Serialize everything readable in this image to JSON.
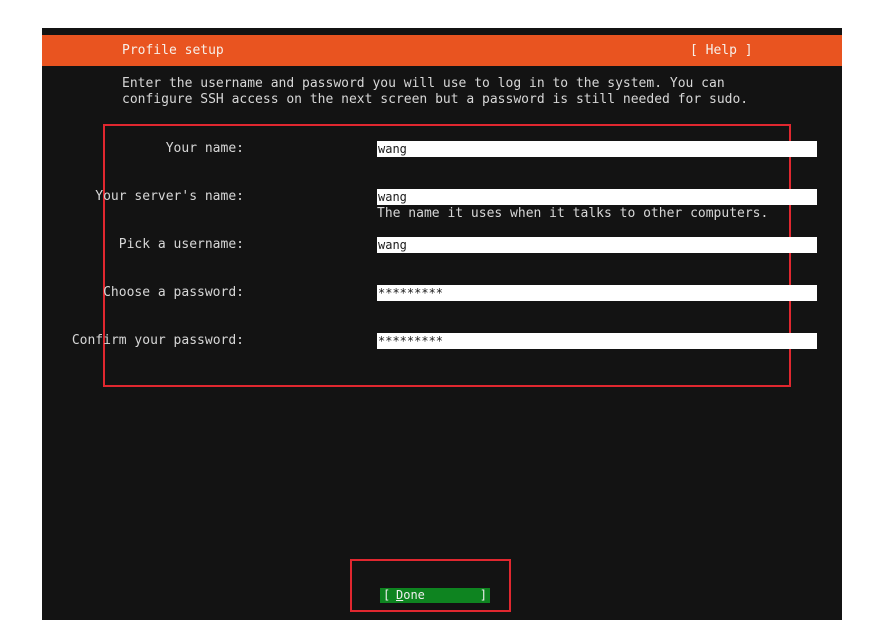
{
  "header": {
    "title": "Profile setup",
    "help_label": "[ Help ]",
    "accent_color": "#e95420"
  },
  "intro": {
    "text": "Enter the username and password you will use to log in to the system. You can configure SSH access on the next screen but a password is still needed for sudo."
  },
  "form": {
    "your_name": {
      "label": "Your name:",
      "value": "wang"
    },
    "server_name": {
      "label": "Your server's name:",
      "value": "wang",
      "hint": "The name it uses when it talks to other computers."
    },
    "username": {
      "label": "Pick a username:",
      "value": "wang"
    },
    "password": {
      "label": "Choose a password:",
      "value": "*********"
    },
    "confirm_password": {
      "label": "Confirm your password:",
      "value": "*********"
    }
  },
  "footer": {
    "done_open_bracket": "[",
    "done_mnemonic": "D",
    "done_rest": "one",
    "done_close_bracket": "]",
    "done_color": "#0e8420"
  },
  "highlight_color": "#e0272f"
}
